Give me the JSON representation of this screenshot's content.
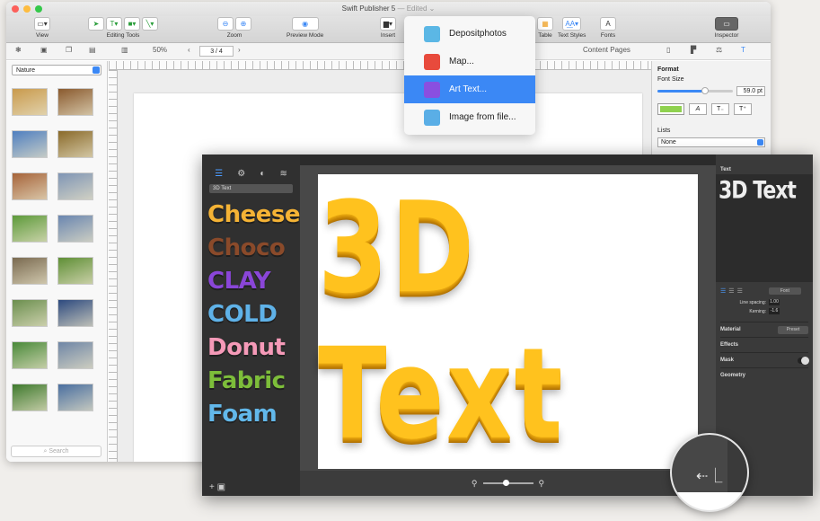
{
  "main_window": {
    "title": "Swift Publisher 5",
    "edited": "— Edited ⌄",
    "toolbar": {
      "view_label": "View",
      "editing_tools_label": "Editing Tools",
      "zoom_label": "Zoom",
      "preview_mode_label": "Preview Mode",
      "insert_label": "Insert",
      "table_label": "Table",
      "text_styles_label": "Text Styles",
      "fonts_label": "Fonts",
      "inspector_label": "Inspector"
    },
    "subbar": {
      "zoom_value": "50%",
      "page_value": "3 / 4",
      "content_pages": "Content Pages"
    },
    "sidebar": {
      "category": "Nature",
      "search_placeholder": "Search",
      "thumbnail_colors": [
        [
          "#c99a4c",
          "#8a5a2e"
        ],
        [
          "#4f7fc0",
          "#8a6a2a"
        ],
        [
          "#a6643a",
          "#7f95b5"
        ],
        [
          "#5d9a3a",
          "#6a86b0"
        ],
        [
          "#7a6a50",
          "#5f8f36"
        ],
        [
          "#6b8f4e",
          "#2d4a7f"
        ],
        [
          "#4a8a3a",
          "#6f86a6"
        ],
        [
          "#3f7a2e",
          "#4a6fa0"
        ]
      ]
    },
    "inspector": {
      "format_label": "Format",
      "font_size_label": "Font Size",
      "font_size_value": "59.0 pt",
      "italic_label": "A",
      "t_down": "T₋",
      "t_up": "T⁺",
      "lists_label": "Lists",
      "lists_value": "None",
      "text_color": "#8fd14f"
    }
  },
  "insert_menu": {
    "items": [
      {
        "label": "Depositphotos",
        "icon": "depositphotos-icon",
        "color": "#5bb7e5"
      },
      {
        "label": "Map...",
        "icon": "map-pin-icon",
        "color": "#e84a3c"
      },
      {
        "label": "Art Text...",
        "icon": "art-text-icon",
        "color": "#8a4fe0"
      },
      {
        "label": "Image from file...",
        "icon": "folder-icon",
        "color": "#5aaee6"
      }
    ],
    "active_index": 2
  },
  "art_text_window": {
    "style_select": "3D Text",
    "styles": [
      {
        "label": "Cheese",
        "color": "#f5b335"
      },
      {
        "label": "Choco",
        "color": "#8a4a2a"
      },
      {
        "label": "CLAY",
        "color": "#8a46d8"
      },
      {
        "label": "COLD",
        "color": "#5fb2e8"
      },
      {
        "label": "Donut",
        "color": "#f59ab8"
      },
      {
        "label": "Fabric",
        "color": "#7dbe3a"
      },
      {
        "label": "Foam",
        "color": "#62b8ea"
      }
    ],
    "canvas_text": "3D Text",
    "inspector": {
      "text_header": "Text",
      "preview_text": "3D Text",
      "font_button": "Font",
      "line_spacing_label": "Line spacing:",
      "line_spacing_value": "1.00",
      "kerning_label": "Kerning:",
      "kerning_value": "-1.6",
      "material_label": "Material",
      "preset_label": "Preset",
      "effects_label": "Effects",
      "mask_label": "Mask",
      "geometry_label": "Geometry"
    }
  }
}
